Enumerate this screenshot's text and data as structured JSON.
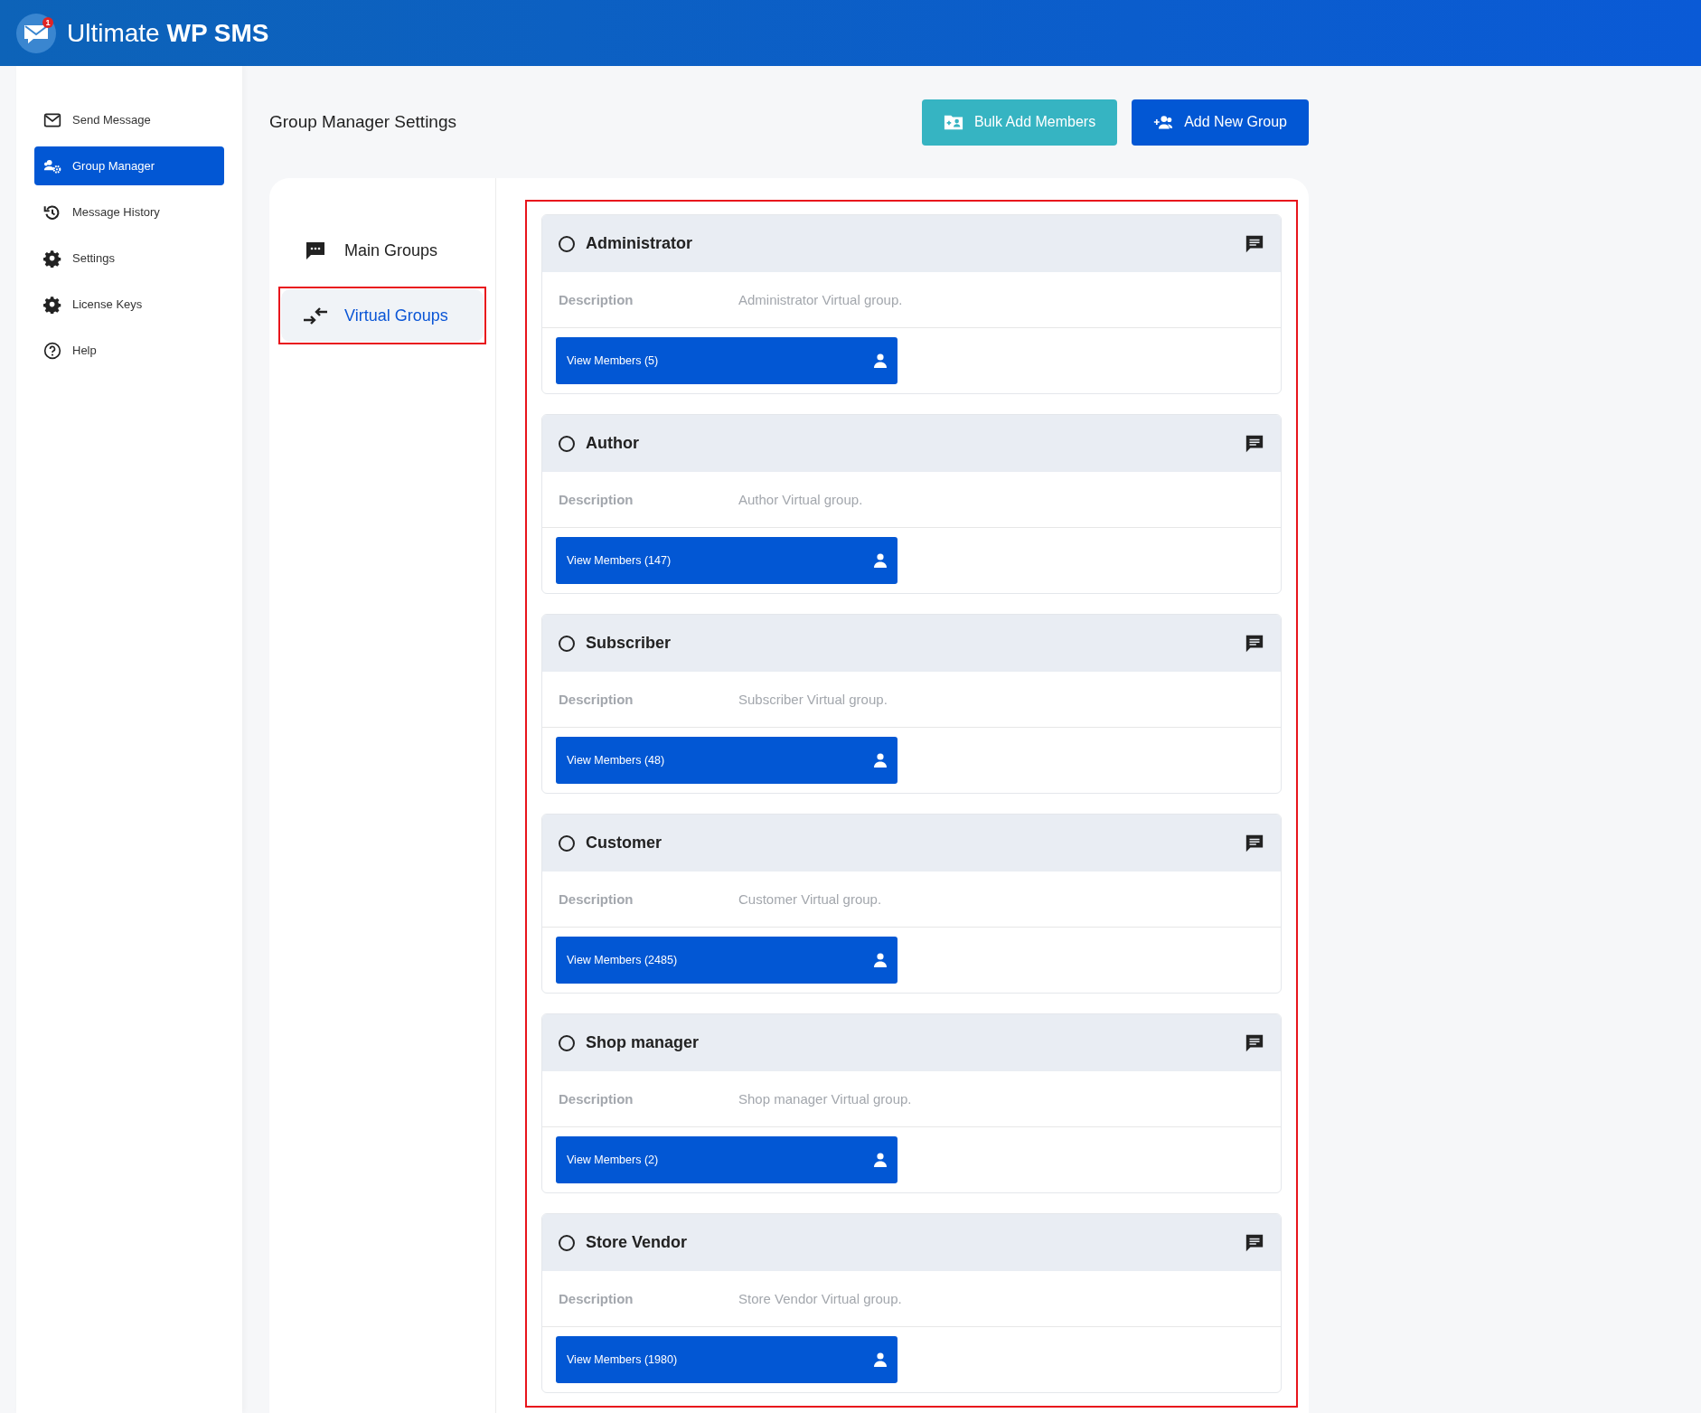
{
  "app": {
    "title_light": "Ultimate",
    "title_bold": "WP SMS",
    "badge": "1"
  },
  "sidebar": {
    "items": [
      {
        "label": "Send Message",
        "kind": "envelope",
        "selected": false
      },
      {
        "label": "Group Manager",
        "kind": "users",
        "selected": true
      },
      {
        "label": "Message History",
        "kind": "history",
        "selected": false
      },
      {
        "label": "Settings",
        "kind": "gear",
        "selected": false
      },
      {
        "label": "License Keys",
        "kind": "gear",
        "selected": false
      },
      {
        "label": "Help",
        "kind": "help",
        "selected": false
      }
    ]
  },
  "page": {
    "title": "Group Manager Settings"
  },
  "actions": [
    {
      "label": "Bulk Add Members",
      "kind": "secondary"
    },
    {
      "label": "Add New Group",
      "kind": "primary"
    }
  ],
  "tabs": [
    {
      "label": "Main Groups",
      "kind": "chat",
      "selected": false,
      "highlighted": false
    },
    {
      "label": "Virtual Groups",
      "kind": "swap",
      "selected": true,
      "highlighted": true
    }
  ],
  "groups_highlighted": true,
  "groups": [
    {
      "name": "Administrator",
      "selected": false,
      "description_label": "Description",
      "description": "Administrator Virtual group.",
      "button": "View Members (5)"
    },
    {
      "name": "Author",
      "selected": false,
      "description_label": "Description",
      "description": "Author Virtual group.",
      "button": "View Members (147)"
    },
    {
      "name": "Subscriber",
      "selected": false,
      "description_label": "Description",
      "description": "Subscriber Virtual group.",
      "button": "View Members (48)"
    },
    {
      "name": "Customer",
      "selected": false,
      "description_label": "Description",
      "description": "Customer Virtual group.",
      "button": "View Members (2485)"
    },
    {
      "name": "Shop manager",
      "selected": false,
      "description_label": "Description",
      "description": "Shop manager Virtual group.",
      "button": "View Members (2)"
    },
    {
      "name": "Store Vendor",
      "selected": false,
      "description_label": "Description",
      "description": "Store Vendor Virtual group.",
      "button": "View Members (1980)"
    }
  ]
}
